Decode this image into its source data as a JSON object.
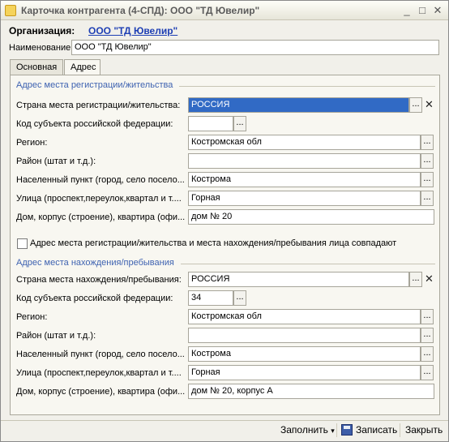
{
  "window": {
    "title": "Карточка контрагента (4-СПД): ООО \"ТД Ювелир\"",
    "controls": [
      "_",
      "□",
      "✕"
    ]
  },
  "org": {
    "label": "Организация:",
    "value": "ООО \"ТД Ювелир\""
  },
  "name": {
    "label": "Наименование:",
    "value": "ООО \"ТД Ювелир\""
  },
  "tabs": [
    {
      "label": "Основная"
    },
    {
      "label": "Адрес"
    }
  ],
  "registration": {
    "title": "Адрес места регистрации/жительства",
    "rows": [
      {
        "label": "Страна места регистрации/жительства:",
        "value": "РОССИЯ"
      },
      {
        "label": "Код субъекта российской федерации:",
        "value": ""
      },
      {
        "label": "Регион:",
        "value": "Костромская обл"
      },
      {
        "label": "Район (штат и т.д.):",
        "value": ""
      },
      {
        "label": "Населенный пункт (город, село посело...",
        "value": "Кострома"
      },
      {
        "label": "Улица (проспект,переулок,квартал и т....",
        "value": "Горная"
      },
      {
        "label": "Дом, корпус (строение), квартира (офи...",
        "value": "дом № 20"
      }
    ]
  },
  "same_address": {
    "label": "Адрес места регистрации/жительства и места нахождения/пребывания лица совпадают",
    "checked": false
  },
  "location": {
    "title": "Адрес места нахождения/пребывания",
    "rows": [
      {
        "label": "Страна места нахождения/пребывания:",
        "value": "РОССИЯ"
      },
      {
        "label": "Код субъекта российской федерации:",
        "value": "34"
      },
      {
        "label": "Регион:",
        "value": "Костромская обл"
      },
      {
        "label": "Район (штат и т.д.):",
        "value": ""
      },
      {
        "label": "Населенный пункт (город, село посело...",
        "value": "Кострома"
      },
      {
        "label": "Улица (проспект,переулок,квартал и т....",
        "value": "Горная"
      },
      {
        "label": "Дом, корпус (строение), квартира (офи...",
        "value": "дом № 20, корпус А"
      }
    ]
  },
  "footer": {
    "fill_label": "Заполнить",
    "save_label": "Записать",
    "close_label": "Закрыть"
  }
}
